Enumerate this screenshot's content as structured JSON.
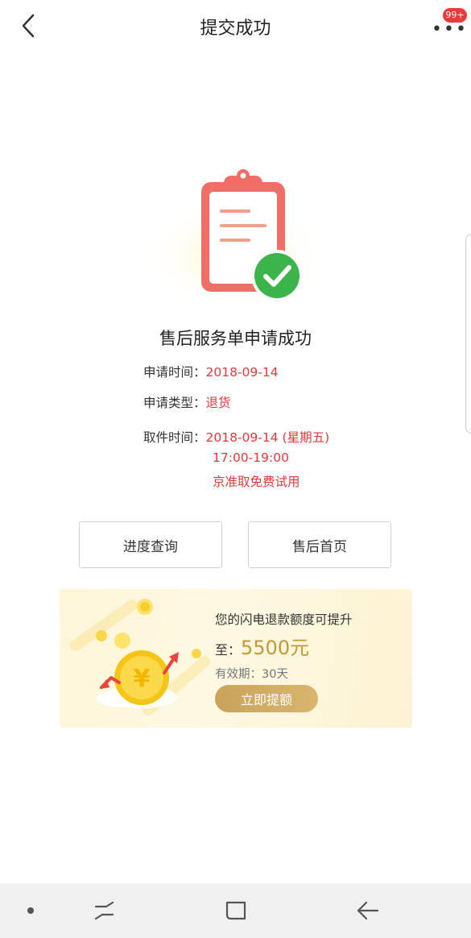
{
  "header": {
    "title": "提交成功",
    "badge": "99+",
    "more": "•••"
  },
  "result": {
    "title": "售后服务单申请成功",
    "apply_time_label": "申请时间：",
    "apply_time_value": "2018-09-14",
    "apply_type_label": "申请类型：",
    "apply_type_value": "退货",
    "pickup_label": "取件时间：",
    "pickup_date": "2018-09-14 (星期五)",
    "pickup_range": "17:00-19:00",
    "pickup_note": "京准取免费试用"
  },
  "actions": {
    "progress": "进度查询",
    "home": "售后首页"
  },
  "promo": {
    "line1": "您的闪电退款额度可提升",
    "prefix": "至：",
    "amount": "5500元",
    "validity": "有效期：30天",
    "button": "立即提额"
  },
  "colors": {
    "accent": "#e4393c",
    "gold": "#c09a37",
    "check_green": "#3db44a"
  },
  "icons": [
    "back-arrow-icon",
    "more-icon",
    "clipboard-icon",
    "checkmark-icon",
    "coin-icon",
    "home-dot-icon",
    "recent-apps-icon",
    "home-square-icon",
    "nav-back-icon"
  ]
}
